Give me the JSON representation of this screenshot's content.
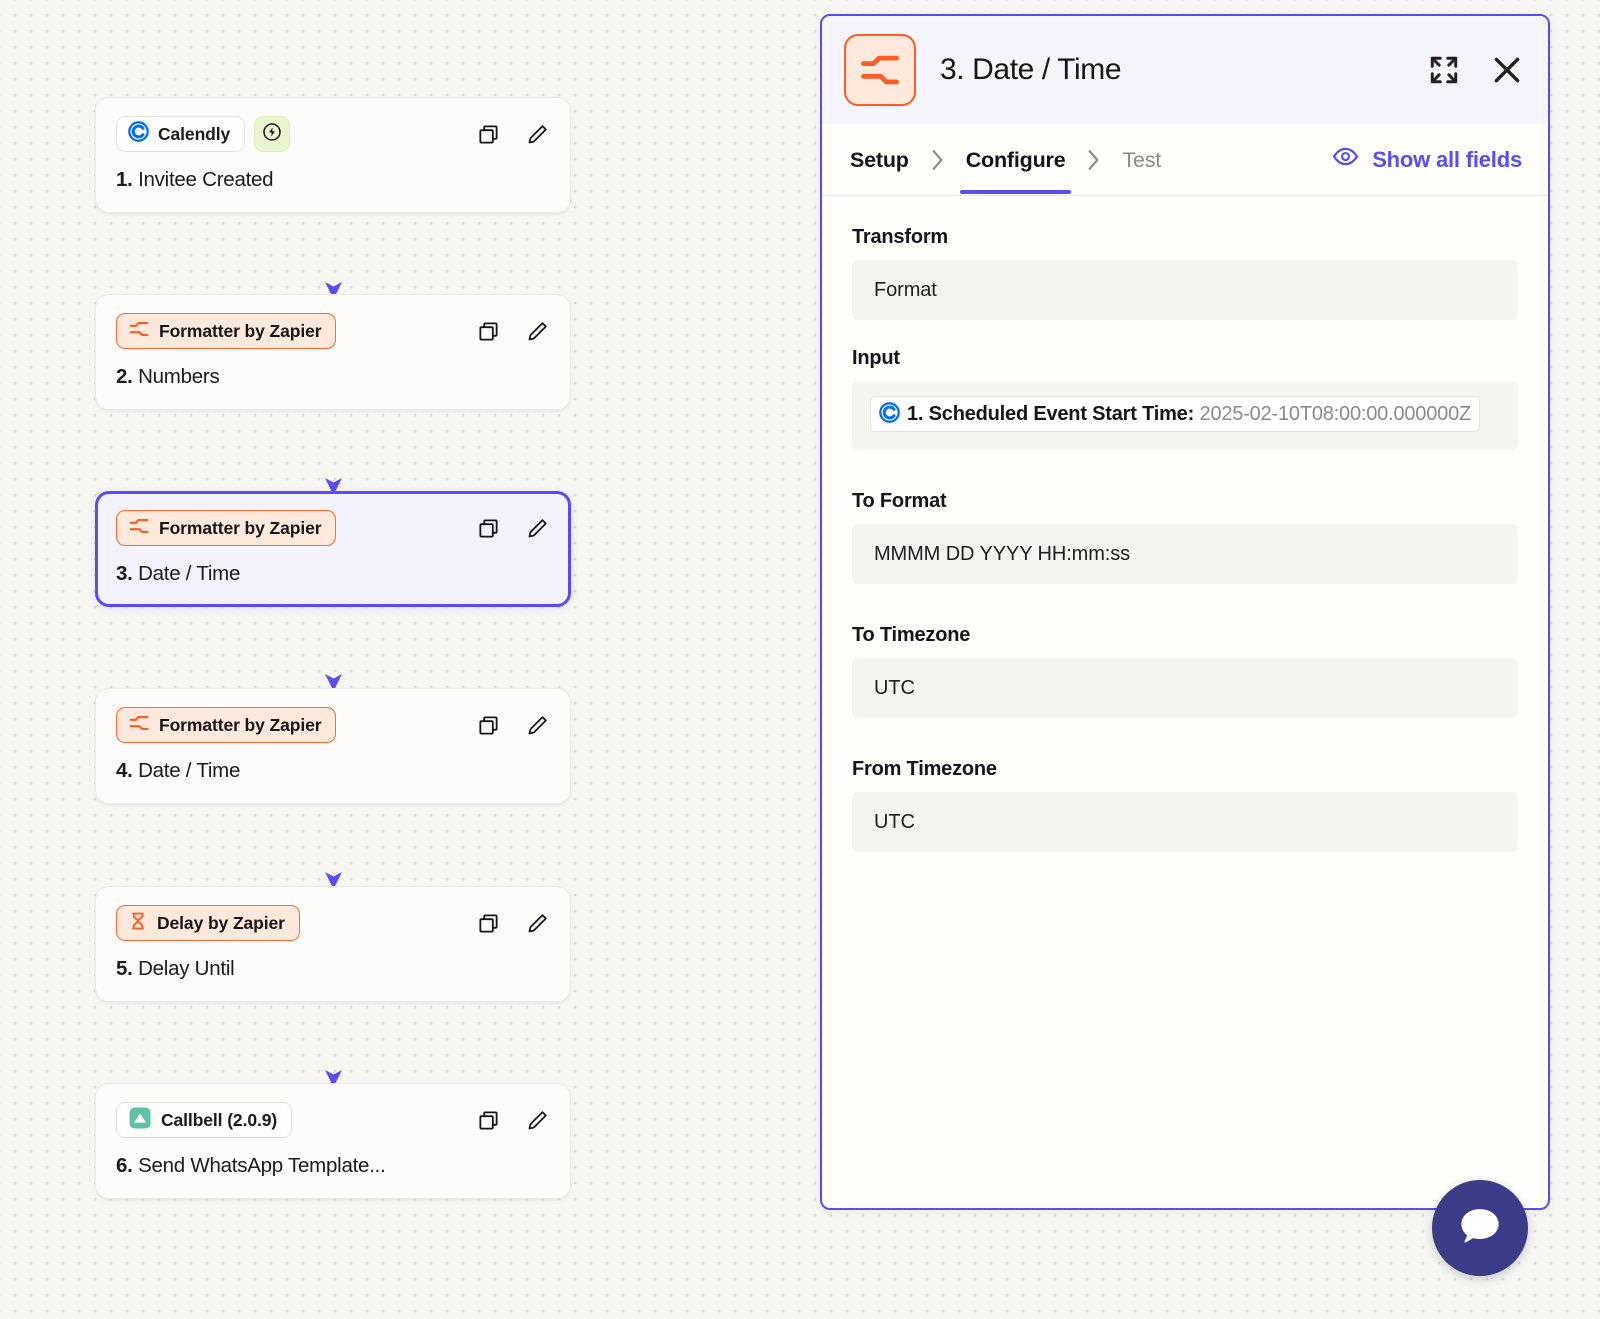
{
  "canvas": {
    "steps": [
      {
        "app_label": "Calendly",
        "app_icon": "calendly-icon",
        "chip_style": "plain",
        "has_trigger_badge": true,
        "trigger_badge_icon": "lightning-bolt-icon",
        "number": "1.",
        "title": "Invitee Created",
        "selected": false,
        "copy_icon": "copy-icon",
        "edit_icon": "pencil-icon"
      },
      {
        "app_label": "Formatter by Zapier",
        "app_icon": "formatter-icon",
        "chip_style": "orange",
        "has_trigger_badge": false,
        "number": "2.",
        "title": "Numbers",
        "selected": false,
        "copy_icon": "copy-icon",
        "edit_icon": "pencil-icon"
      },
      {
        "app_label": "Formatter by Zapier",
        "app_icon": "formatter-icon",
        "chip_style": "orange",
        "has_trigger_badge": false,
        "number": "3.",
        "title": "Date / Time",
        "selected": true,
        "copy_icon": "copy-icon",
        "edit_icon": "pencil-icon"
      },
      {
        "app_label": "Formatter by Zapier",
        "app_icon": "formatter-icon",
        "chip_style": "orange",
        "has_trigger_badge": false,
        "number": "4.",
        "title": "Date / Time",
        "selected": false,
        "copy_icon": "copy-icon",
        "edit_icon": "pencil-icon"
      },
      {
        "app_label": "Delay by Zapier",
        "app_icon": "hourglass-icon",
        "chip_style": "orange",
        "has_trigger_badge": false,
        "number": "5.",
        "title": "Delay Until",
        "selected": false,
        "copy_icon": "copy-icon",
        "edit_icon": "pencil-icon"
      },
      {
        "app_label": "Callbell (2.0.9)",
        "app_icon": "callbell-icon",
        "chip_style": "plain",
        "has_trigger_badge": false,
        "number": "6.",
        "title": "Send WhatsApp Template...",
        "selected": false,
        "copy_icon": "copy-icon",
        "edit_icon": "pencil-icon"
      }
    ]
  },
  "panel": {
    "app_icon": "formatter-icon",
    "title": "3. Date / Time",
    "expand_icon": "expand-icon",
    "close_icon": "close-icon",
    "tabs": [
      {
        "label": "Setup",
        "state": "done"
      },
      {
        "label": "Configure",
        "state": "active"
      },
      {
        "label": "Test",
        "state": "inactive"
      }
    ],
    "tab_separator": "›",
    "show_all_fields": {
      "label": "Show all fields",
      "icon": "eye-icon"
    },
    "fields": [
      {
        "label": "Transform",
        "value": "Format",
        "type": "text"
      },
      {
        "label": "Input",
        "type": "token",
        "token_icon": "calendly-icon",
        "token_label": "1. Scheduled Event Start Time:",
        "token_value": "2025-02-10T08:00:00.000000Z"
      },
      {
        "label": "To Format",
        "value": "MMMM DD YYYY HH:mm:ss",
        "type": "text"
      },
      {
        "label": "To Timezone",
        "value": "UTC",
        "type": "text"
      },
      {
        "label": "From Timezone",
        "value": "UTC",
        "type": "text"
      }
    ]
  },
  "chat_widget": {
    "icon": "chat-bubble-icon"
  },
  "colors": {
    "accent_purple": "#5b4bf5",
    "zapier_orange": "#ff5b22",
    "calendly_blue": "#006bff",
    "callbell_green": "#5fc2a5",
    "trigger_green_bg": "#eaf6cf",
    "canvas_bg": "#f7f6f3",
    "panel_header_bg": "#f6f5fe",
    "chat_navy": "#3b3b87"
  }
}
